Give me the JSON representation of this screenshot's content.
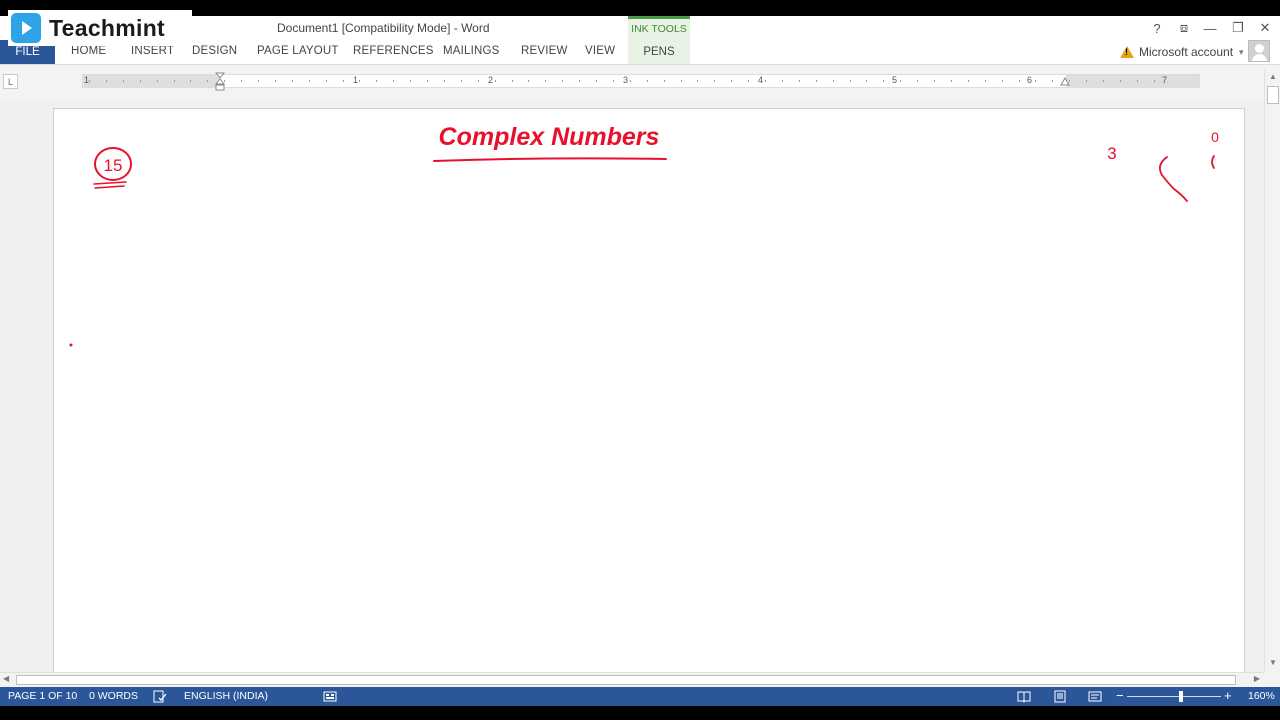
{
  "window": {
    "title": "Document1 [Compatibility Mode] - Word",
    "help": "?",
    "ribbon_display": "⧈",
    "minimize": "—",
    "restore": "❐",
    "close": "✕"
  },
  "logo": {
    "text": "Teachmint"
  },
  "tabs": {
    "file": "FILE",
    "home": "HOME",
    "insert": "INSERT",
    "design": "DESIGN",
    "page_layout": "PAGE LAYOUT",
    "references": "REFERENCES",
    "mailings": "MAILINGS",
    "review": "REVIEW",
    "view": "VIEW",
    "ink_tools": "INK TOOLS",
    "pens": "PENS"
  },
  "account": {
    "label": "Microsoft account",
    "caret": "▾"
  },
  "ruler": {
    "numbers": [
      "1",
      "1",
      "2",
      "3",
      "4",
      "5",
      "6",
      "7"
    ]
  },
  "document": {
    "handwriting": {
      "title": "Complex Numbers",
      "circled_number": "15",
      "margin_marks": [
        "3",
        "0"
      ]
    },
    "ink_color": "#e8112d"
  },
  "statusbar": {
    "page": "PAGE 1 OF 10",
    "words": "0 WORDS",
    "language": "ENGLISH (INDIA)",
    "zoom_minus": "−",
    "zoom_plus": "+",
    "zoom": "160%"
  },
  "colors": {
    "ribbon_blue": "#2b579a",
    "ink_tools_green": "#4c9a46",
    "status_bar": "#2b579a"
  }
}
